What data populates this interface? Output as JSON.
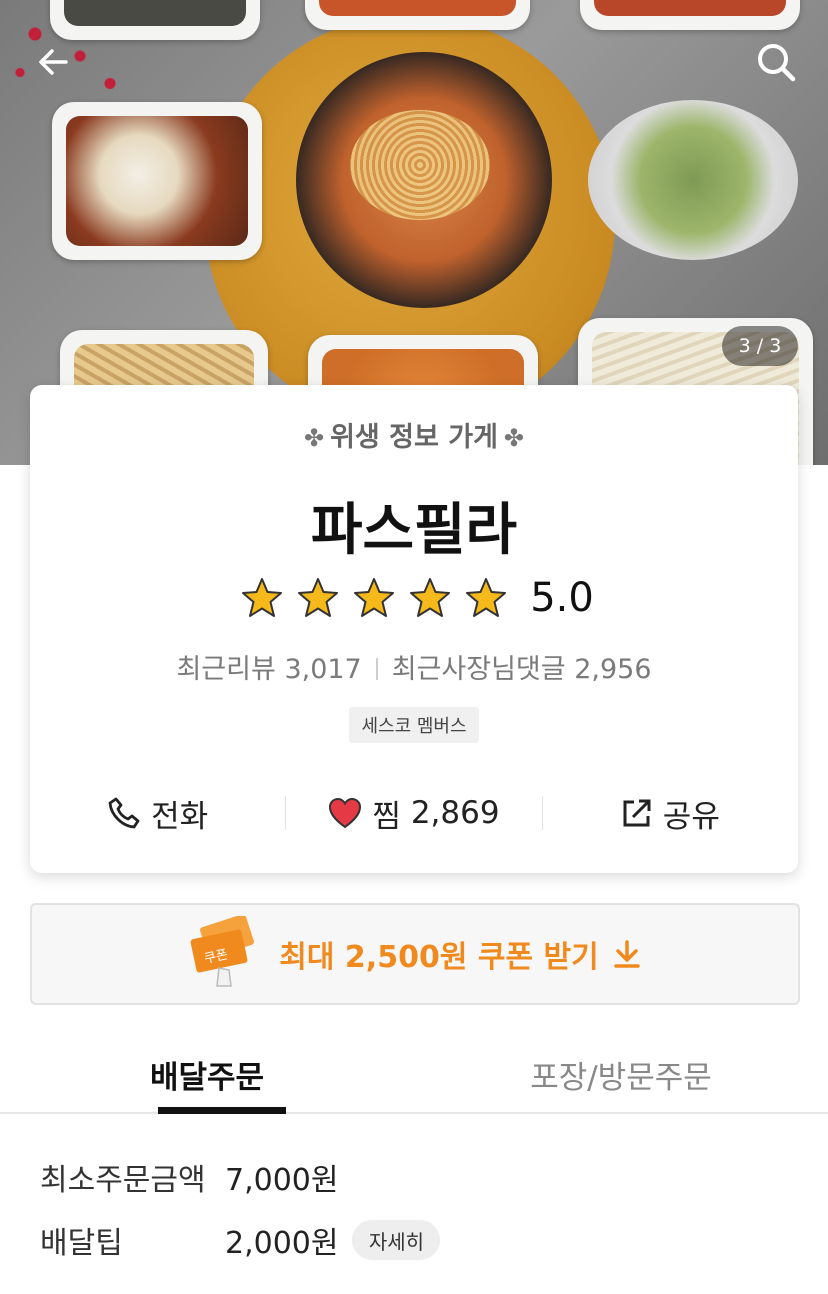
{
  "hero": {
    "page_indicator": "3 / 3",
    "back_icon": "arrow-left-icon",
    "search_icon": "search-icon"
  },
  "store": {
    "badge": "위생 정보 가게",
    "name": "파스필라",
    "rating": "5.0",
    "star_count": 5,
    "recent_reviews_label": "최근리뷰",
    "recent_reviews_count": "3,017",
    "owner_replies_label": "최근사장님댓글",
    "owner_replies_count": "2,956",
    "member_tag": "세스코 멤버스"
  },
  "actions": {
    "call_label": "전화",
    "like_label": "찜",
    "like_count": "2,869",
    "share_label": "공유"
  },
  "coupon": {
    "text": "최대 2,500원 쿠폰 받기",
    "ticket_label": "쿠폰"
  },
  "tabs": [
    {
      "label": "배달주문"
    },
    {
      "label": "포장/방문주문"
    }
  ],
  "info": {
    "min_order_label": "최소주문금액",
    "min_order_value": "7,000원",
    "delivery_tip_label": "배달팁",
    "delivery_tip_value": "2,000원",
    "detail_button": "자세히"
  },
  "colors": {
    "accent": "#f08a1e",
    "star": "#f6b91b",
    "heart": "#e53946"
  }
}
